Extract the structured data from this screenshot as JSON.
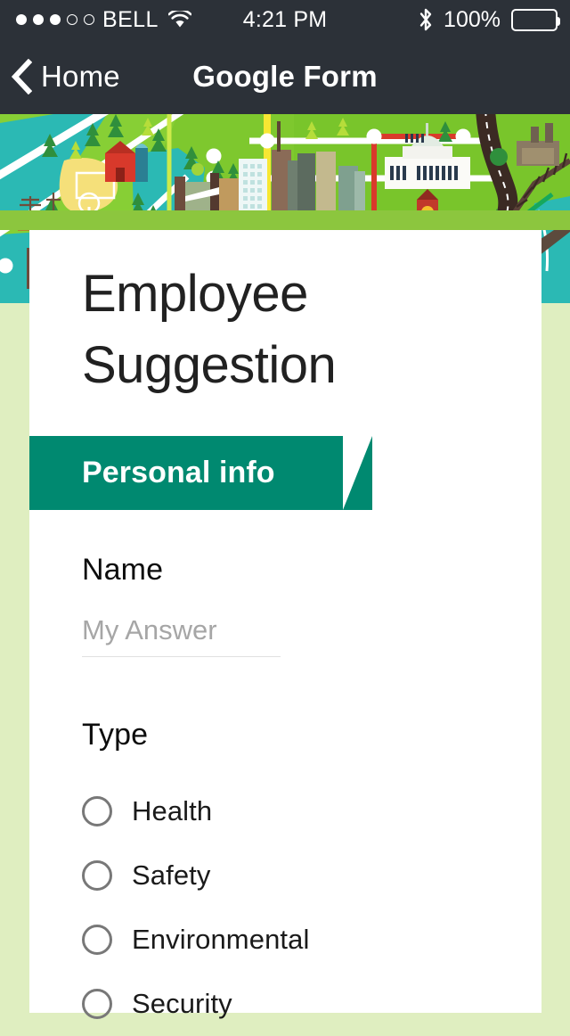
{
  "status_bar": {
    "carrier": "BELL",
    "signal_dots_filled": 3,
    "signal_dots_total": 5,
    "wifi_icon": "wifi-icon",
    "time": "4:21 PM",
    "bluetooth_icon": "bluetooth-icon",
    "battery_percent": "100%",
    "battery_icon": "battery-full-icon",
    "background_color": "#2c3138",
    "text_color": "#ffffff"
  },
  "nav_bar": {
    "back_icon": "chevron-left-icon",
    "back_label": "Home",
    "title": "Google Form",
    "background_color": "#2c3138"
  },
  "banner": {
    "image_name": "city-map-illustration",
    "description": "Illustrated green city and countryside map banner",
    "base_green": "#7ec82e",
    "band_green": "#8cc63e",
    "water_color": "#2bb9b4"
  },
  "form": {
    "title": "Employee Suggestion",
    "title_lines": [
      "Employee",
      "Suggestion"
    ],
    "section": {
      "label": "Personal info",
      "color": "#008970"
    },
    "questions": [
      {
        "label": "Name",
        "type": "text",
        "value": "",
        "placeholder": "My Answer"
      },
      {
        "label": "Type",
        "type": "radio",
        "selected": null,
        "options": [
          {
            "label": "Health"
          },
          {
            "label": "Safety"
          },
          {
            "label": "Environmental"
          },
          {
            "label": "Security"
          }
        ]
      }
    ]
  },
  "page": {
    "background_color": "#dfeec0",
    "card_color": "#ffffff"
  }
}
